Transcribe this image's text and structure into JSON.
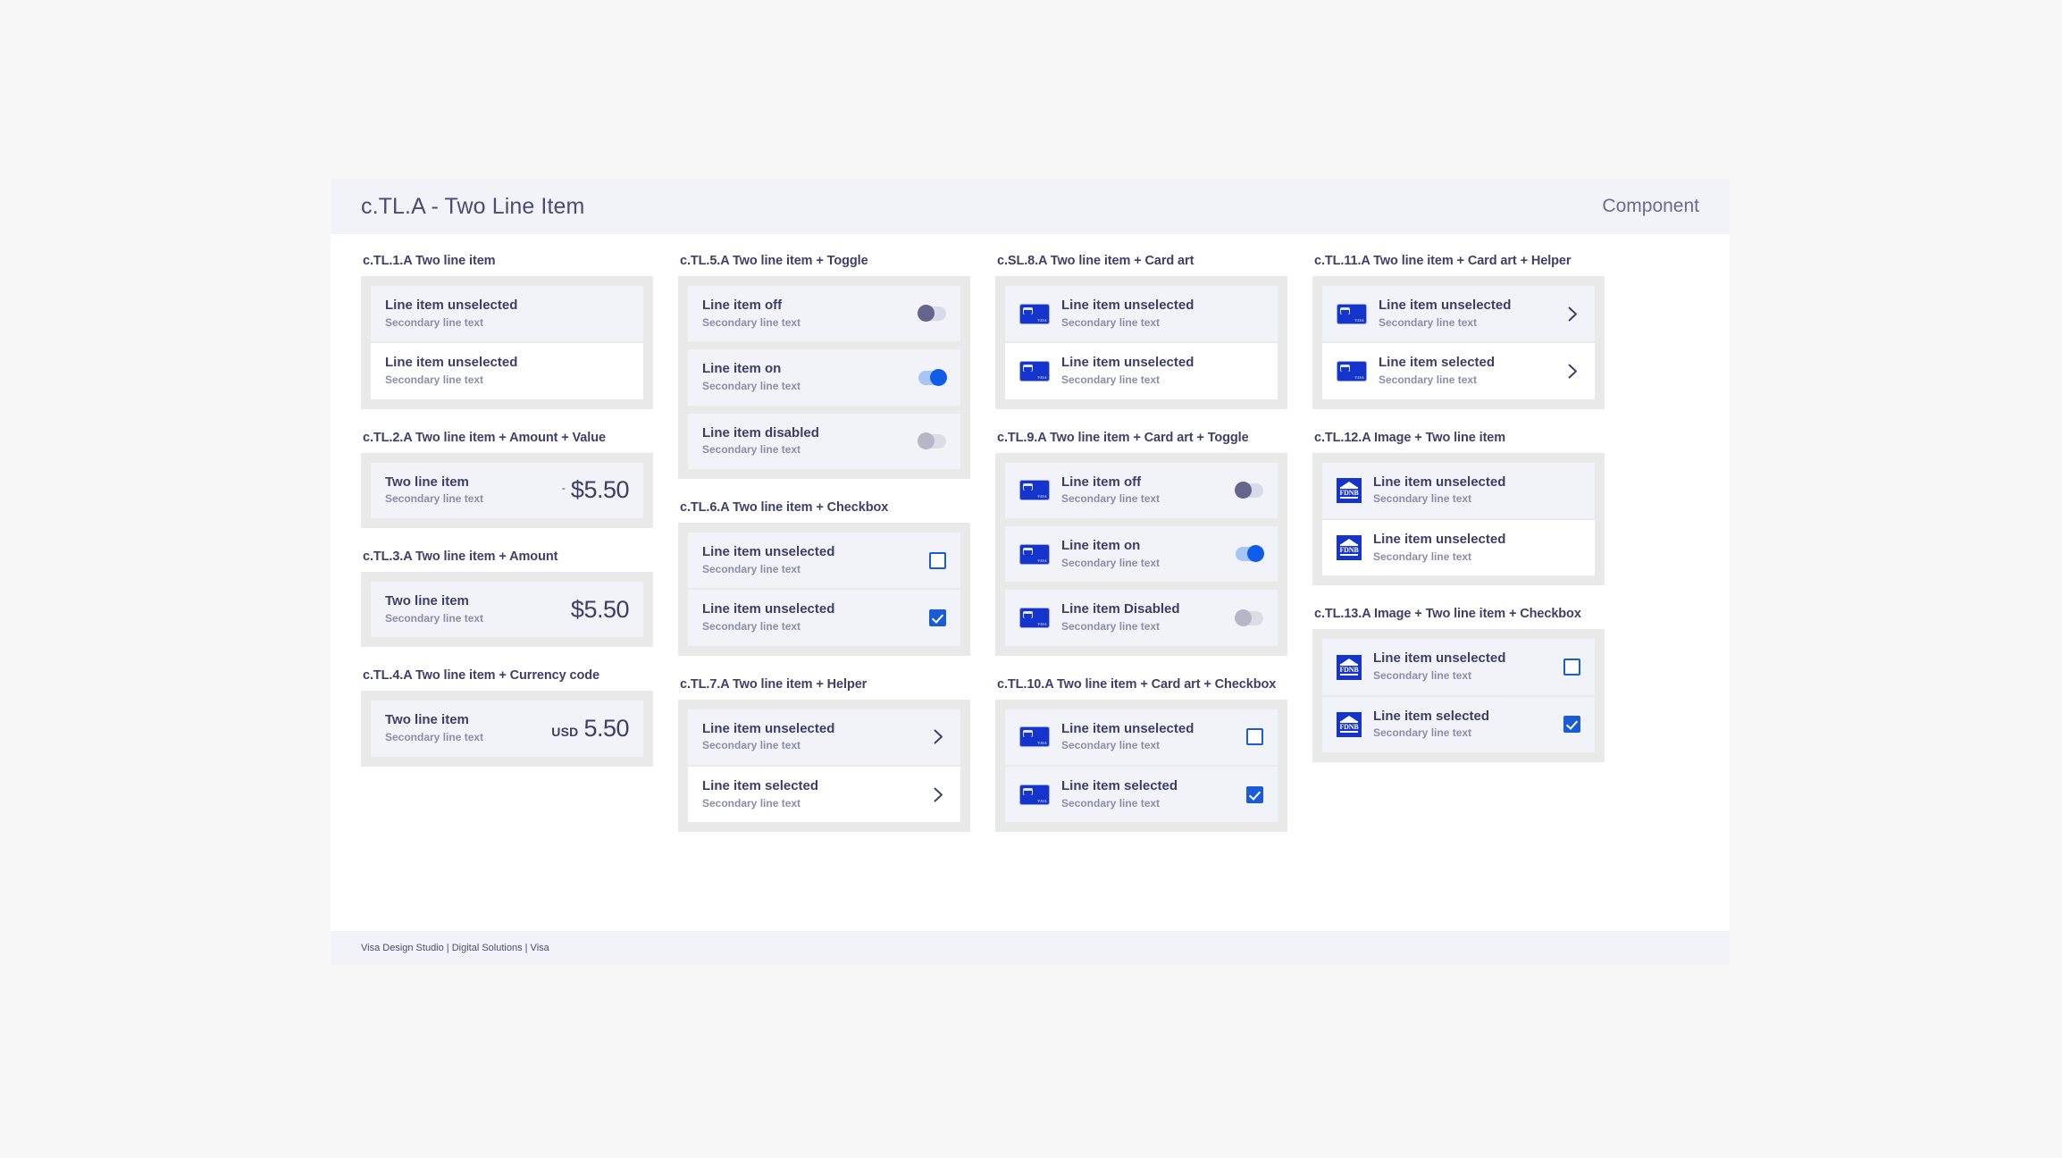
{
  "header": {
    "title": "c.TL.A - Two Line Item",
    "meta": "Component"
  },
  "footer": {
    "text": "Visa Design Studio | Digital Solutions | Visa"
  },
  "secondary_text": "Secondary line text",
  "columns": [
    {
      "groups": [
        {
          "spec": "c.TL.1.A Two line item",
          "rows": [
            {
              "primary": "Line item unselected",
              "secondary": "Secondary line text",
              "state": "selected"
            },
            {
              "primary": "Line item unselected",
              "secondary": "Secondary line text",
              "state": "default"
            }
          ]
        },
        {
          "spec": "c.TL.2.A Two line item + Amount + Value",
          "rows": [
            {
              "primary": "Two line item",
              "secondary": "Secondary line text",
              "state": "selected",
              "amount": {
                "prefix": "-",
                "code": "",
                "value": "$5.50"
              }
            }
          ]
        },
        {
          "spec": "c.TL.3.A Two line item + Amount",
          "rows": [
            {
              "primary": "Two line item",
              "secondary": "Secondary line text",
              "state": "selected",
              "amount": {
                "prefix": "",
                "code": "",
                "value": "$5.50"
              }
            }
          ]
        },
        {
          "spec": "c.TL.4.A Two line item + Currency code",
          "rows": [
            {
              "primary": "Two line item",
              "secondary": "Secondary line text",
              "state": "selected",
              "amount": {
                "prefix": "",
                "code": "USD",
                "value": "5.50"
              }
            }
          ]
        }
      ]
    },
    {
      "groups": [
        {
          "spec": "c.TL.5.A Two line item + Toggle",
          "rows": [
            {
              "primary": "Line item off",
              "secondary": "Secondary line text",
              "state": "selected",
              "toggle": "off"
            },
            {
              "primary": "Line item on",
              "secondary": "Secondary line text",
              "state": "selected",
              "toggle": "on"
            },
            {
              "primary": "Line item disabled",
              "secondary": "Secondary line text",
              "state": "selected",
              "toggle": "disabled"
            }
          ]
        },
        {
          "spec": "c.TL.6.A Two line item + Checkbox",
          "rows": [
            {
              "primary": "Line item unselected",
              "secondary": "Secondary line text",
              "state": "selected",
              "checkbox": "unchecked"
            },
            {
              "primary": "Line item unselected",
              "secondary": "Secondary line text",
              "state": "selected",
              "checkbox": "checked"
            }
          ]
        },
        {
          "spec": "c.TL.7.A Two line item + Helper",
          "rows": [
            {
              "primary": "Line item unselected",
              "secondary": "Secondary line text",
              "state": "selected",
              "chevron": true
            },
            {
              "primary": "Line item selected",
              "secondary": "Secondary line text",
              "state": "default",
              "chevron": true
            }
          ]
        }
      ]
    },
    {
      "groups": [
        {
          "spec": "c.SL.8.A Two line item + Card art",
          "rows": [
            {
              "primary": "Line item unselected",
              "secondary": "Secondary line text",
              "state": "selected",
              "card": true
            },
            {
              "primary": "Line item unselected",
              "secondary": "Secondary line text",
              "state": "default",
              "card": true
            }
          ]
        },
        {
          "spec": "c.TL.9.A Two line item + Card art + Toggle",
          "rows": [
            {
              "primary": "Line item off",
              "secondary": "Secondary line text",
              "state": "selected",
              "card": true,
              "toggle": "off"
            },
            {
              "primary": "Line item on",
              "secondary": "Secondary line text",
              "state": "selected",
              "card": true,
              "toggle": "on"
            },
            {
              "primary": "Line item Disabled",
              "secondary": "Secondary line text",
              "state": "selected",
              "card": true,
              "toggle": "disabled"
            }
          ]
        },
        {
          "spec": "c.TL.10.A Two line item + Card art + Checkbox",
          "rows": [
            {
              "primary": "Line item unselected",
              "secondary": "Secondary line text",
              "state": "selected",
              "card": true,
              "checkbox": "unchecked"
            },
            {
              "primary": "Line item selected",
              "secondary": "Secondary line text",
              "state": "selected",
              "card": true,
              "checkbox": "checked"
            }
          ]
        }
      ]
    },
    {
      "groups": [
        {
          "spec": "c.TL.11.A Two line item + Card art + Helper",
          "rows": [
            {
              "primary": "Line item unselected",
              "secondary": "Secondary line text",
              "state": "selected",
              "card": true,
              "chevron": true
            },
            {
              "primary": "Line item selected",
              "secondary": "Secondary line text",
              "state": "default",
              "card": true,
              "chevron": true
            }
          ]
        },
        {
          "spec": "c.TL.12.A Image + Two line item",
          "rows": [
            {
              "primary": "Line item unselected",
              "secondary": "Secondary line text",
              "state": "selected",
              "image": "FDNB"
            },
            {
              "primary": "Line item unselected",
              "secondary": "Secondary line text",
              "state": "default",
              "image": "FDNB"
            }
          ]
        },
        {
          "spec": "c.TL.13.A Image + Two line item + Checkbox",
          "rows": [
            {
              "primary": "Line item unselected",
              "secondary": "Secondary line text",
              "state": "selected",
              "image": "FDNB",
              "checkbox": "unchecked"
            },
            {
              "primary": "Line item selected",
              "secondary": "Secondary line text",
              "state": "selected",
              "image": "FDNB",
              "checkbox": "checked"
            }
          ]
        }
      ]
    }
  ],
  "colors": {
    "brand_blue": "#1434cb",
    "accent_blue": "#1a5cd8",
    "toggle_on": "#0f5ce8",
    "text_primary": "#3d3d66",
    "text_secondary": "#8c8cab",
    "panel_bg": "#f1f3f9",
    "group_bg": "#e9e9e9"
  },
  "icons": {
    "chevron": "chevron-right-icon",
    "card": "visa-card-art-icon",
    "bank": "bank-logo-icon",
    "check": "checkmark-icon"
  }
}
